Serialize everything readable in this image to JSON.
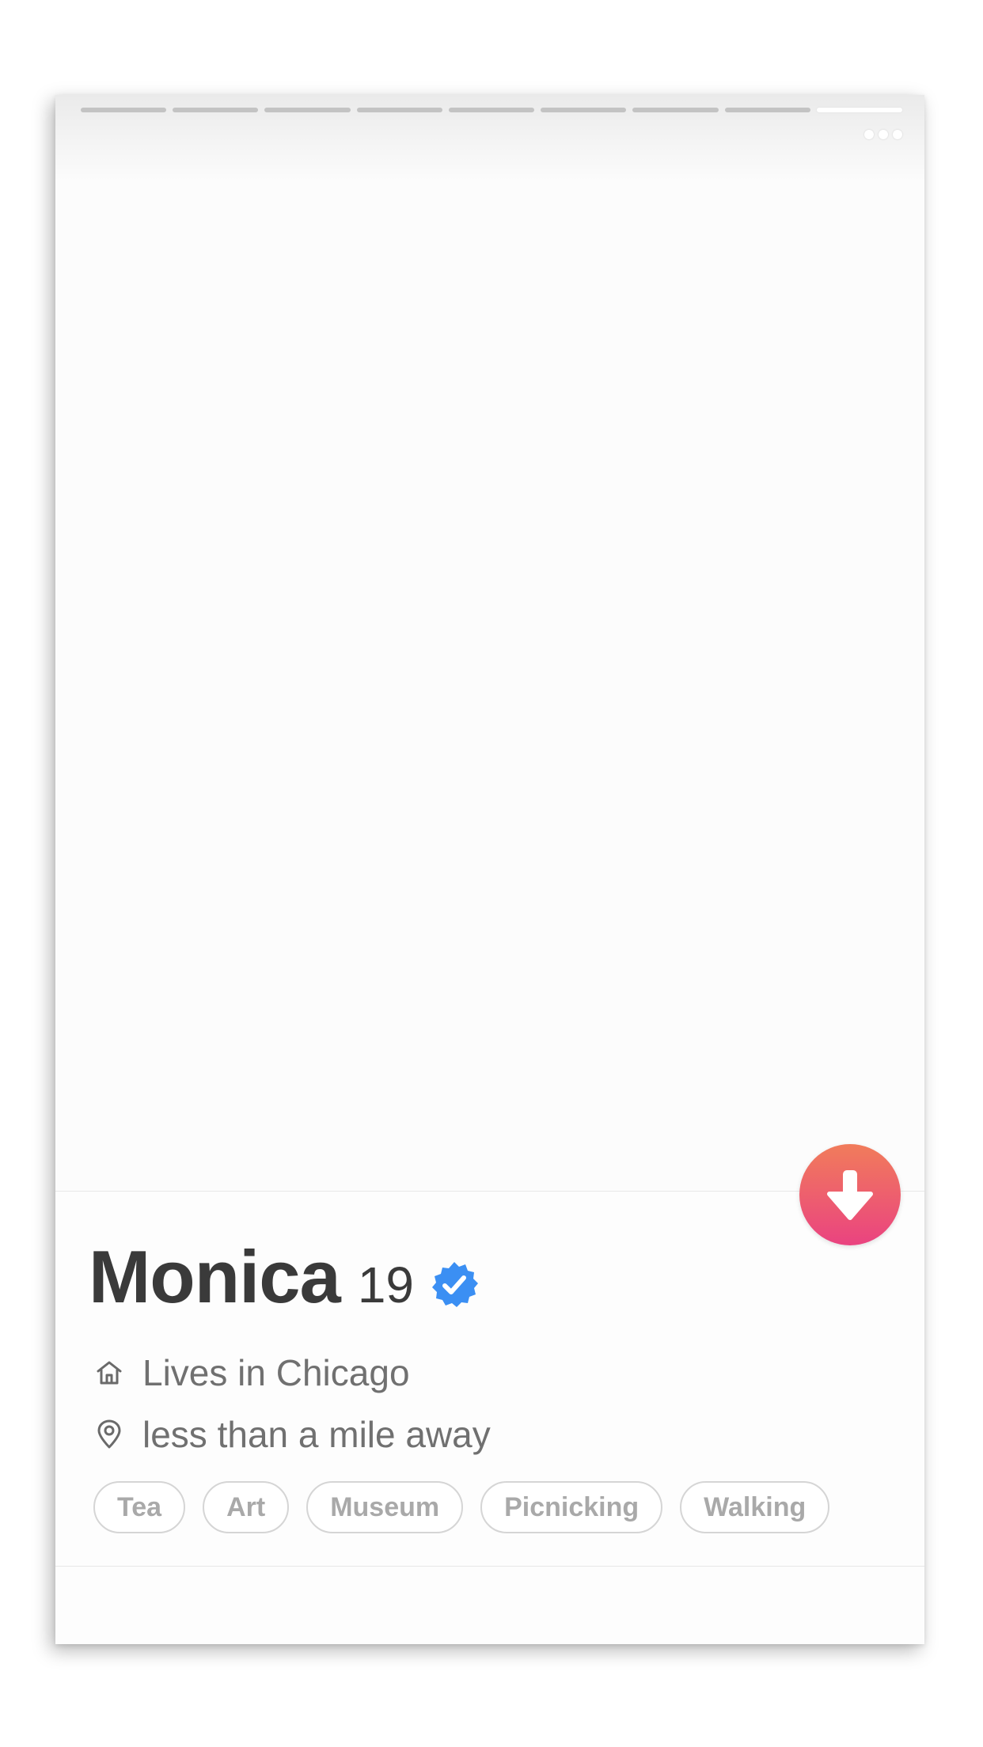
{
  "profile": {
    "name": "Monica",
    "age": "19",
    "verified": true,
    "lives_in": "Lives in Chicago",
    "distance": "less than a mile away",
    "interests": [
      "Tea",
      "Art",
      "Museum",
      "Picnicking",
      "Walking"
    ]
  },
  "photos": {
    "count": 9,
    "active_index": 9
  },
  "icons": {
    "more": "more-dots-icon",
    "collapse": "arrow-down-icon",
    "verified": "verified-badge-icon",
    "home": "home-icon",
    "location": "location-pin-icon"
  },
  "colors": {
    "collapse_gradient_top": "#f17c5b",
    "collapse_gradient_bottom": "#ea4380",
    "verified_blue": "#3b8ff3",
    "name_text": "#3a3a3a",
    "meta_text": "#707070",
    "tag_text": "#a9a9a9",
    "tag_border": "#d5d5d5"
  }
}
